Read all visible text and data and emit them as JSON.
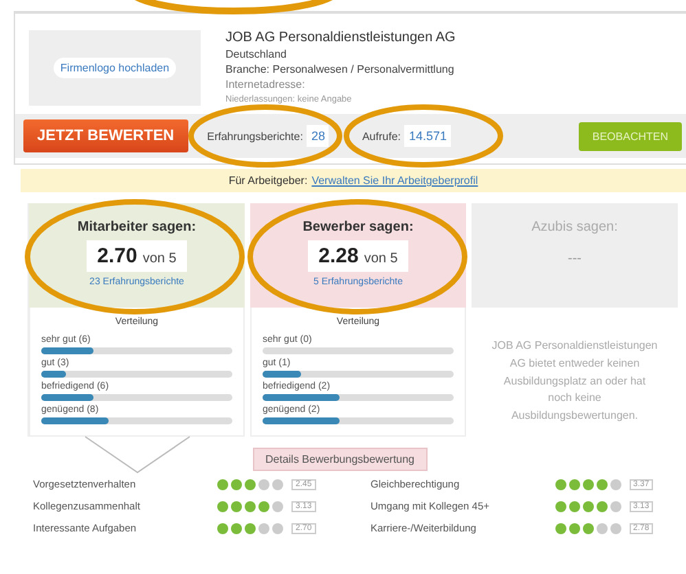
{
  "company": {
    "logo_link": "Firmenlogo hochladen",
    "name": "JOB AG Personaldienstleistungen AG",
    "country": "Deutschland",
    "industry": "Branche: Personalwesen / Personalvermittlung",
    "website_label": "Internetadresse:",
    "note": "Niederlassungen: keine Angabe"
  },
  "actions": {
    "rate_button": "JETZT BEWERTEN",
    "reports_label": "Erfahrungsberichte:",
    "reports_count": "28",
    "views_label": "Aufrufe:",
    "views_count": "14.571",
    "watch_button": "BEOBACHTEN"
  },
  "banner": {
    "prefix": "Für Arbeitgeber:",
    "link": "Verwalten Sie Ihr Arbeitgeberprofil"
  },
  "panels": [
    {
      "kind": "employees",
      "title": "Mitarbeiter sagen:",
      "score": "2.70",
      "scale": "von 5",
      "reports_link": "23 Erfahrungsberichte",
      "distribution_title": "Verteilung",
      "bars": [
        {
          "label": "sehr gut (6)",
          "level": 0.27
        },
        {
          "label": "gut (3)",
          "level": 0.13
        },
        {
          "label": "befriedigend (6)",
          "level": 0.27
        },
        {
          "label": "genügend (8)",
          "level": 0.35
        }
      ]
    },
    {
      "kind": "applicants",
      "title": "Bewerber sagen:",
      "score": "2.28",
      "scale": "von 5",
      "reports_link": "5 Erfahrungsberichte",
      "distribution_title": "Verteilung",
      "bars": [
        {
          "label": "sehr gut (0)"
        },
        {
          "label": "gut (1)",
          "level": 0.2
        },
        {
          "label": "befriedigend (2)",
          "level": 0.4
        },
        {
          "label": "genügend (2)",
          "level": 0.4
        }
      ]
    },
    {
      "kind": "trainees",
      "title": "Azubis sagen:",
      "score": "---",
      "message": "JOB AG Personaldienstleistungen AG bietet entweder keinen Ausbildungsplatz an oder hat noch keine Ausbildungsbewertungen."
    }
  ],
  "details_button": "Details Bewerbungsbewertung",
  "criteria": [
    {
      "name": "Vorgesetztenverhalten",
      "stars": 3,
      "score": "2.45"
    },
    {
      "name": "Gleichberechtigung",
      "stars": 4,
      "score": "3.37"
    },
    {
      "name": "Kollegenzusammenhalt",
      "stars": 4,
      "score": "3.13"
    },
    {
      "name": "Umgang mit Kollegen 45+",
      "stars": 4,
      "score": "3.13"
    },
    {
      "name": "Interessante Aufgaben",
      "stars": 3,
      "score": "2.70"
    },
    {
      "name": "Karriere-/Weiterbildung",
      "stars": 3,
      "score": "2.78"
    }
  ]
}
